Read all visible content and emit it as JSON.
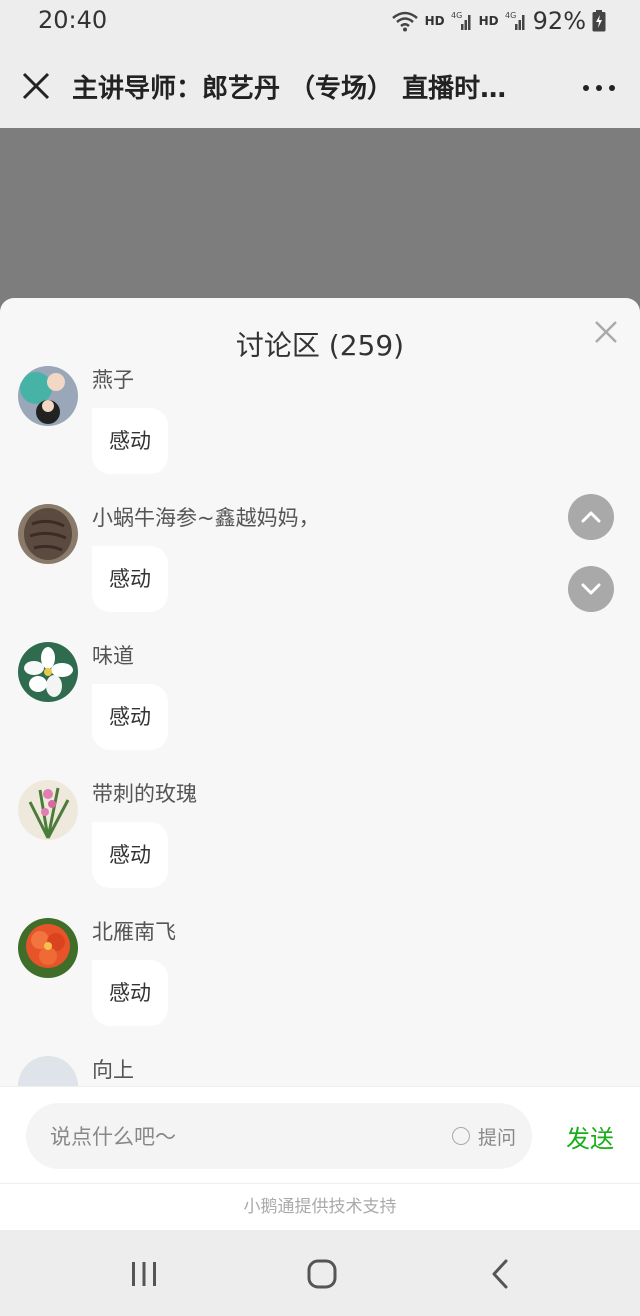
{
  "status_bar": {
    "time": "20:40",
    "network_1": "HD",
    "network_2": "HD",
    "signal_label": "4G",
    "battery": "92%",
    "icons": [
      "wifi-icon",
      "signal-icon",
      "battery-icon"
    ]
  },
  "header": {
    "title": "主讲导师：郎艺丹 （专场） 直播时…",
    "close_icon": "close-icon",
    "more_icon": "more-icon"
  },
  "discussion": {
    "title": "讨论区 (259)",
    "close_icon": "close-icon",
    "messages": [
      {
        "user": "燕子",
        "text": "感动",
        "avatar_colors": [
          "#47b3a6",
          "#9aa7b8"
        ]
      },
      {
        "user": "小蜗牛海参~鑫越妈妈，",
        "text": "感动",
        "avatar_colors": [
          "#5a4a3f",
          "#8a7a6a"
        ]
      },
      {
        "user": "味道",
        "text": "感动",
        "avatar_colors": [
          "#2e6b4f",
          "#ffffff"
        ]
      },
      {
        "user": "带刺的玫瑰",
        "text": "感动",
        "avatar_colors": [
          "#4b7d3a",
          "#e07fb0"
        ]
      },
      {
        "user": "北雁南飞",
        "text": "感动",
        "avatar_colors": [
          "#e8542a",
          "#3f6d2a"
        ]
      },
      {
        "user": "向上",
        "text": "",
        "avatar_colors": [
          "#dfe3ea",
          "#c9ced8"
        ]
      }
    ],
    "scroll_up_icon": "chevron-up-icon",
    "scroll_down_icon": "chevron-down-icon"
  },
  "input": {
    "placeholder": "说点什么吧〜",
    "question_label": "提问",
    "send_label": "发送"
  },
  "footer": {
    "support_text": "小鹅通提供技术支持"
  },
  "nav": {
    "icons": [
      "recent-apps-icon",
      "home-icon",
      "back-icon"
    ]
  }
}
